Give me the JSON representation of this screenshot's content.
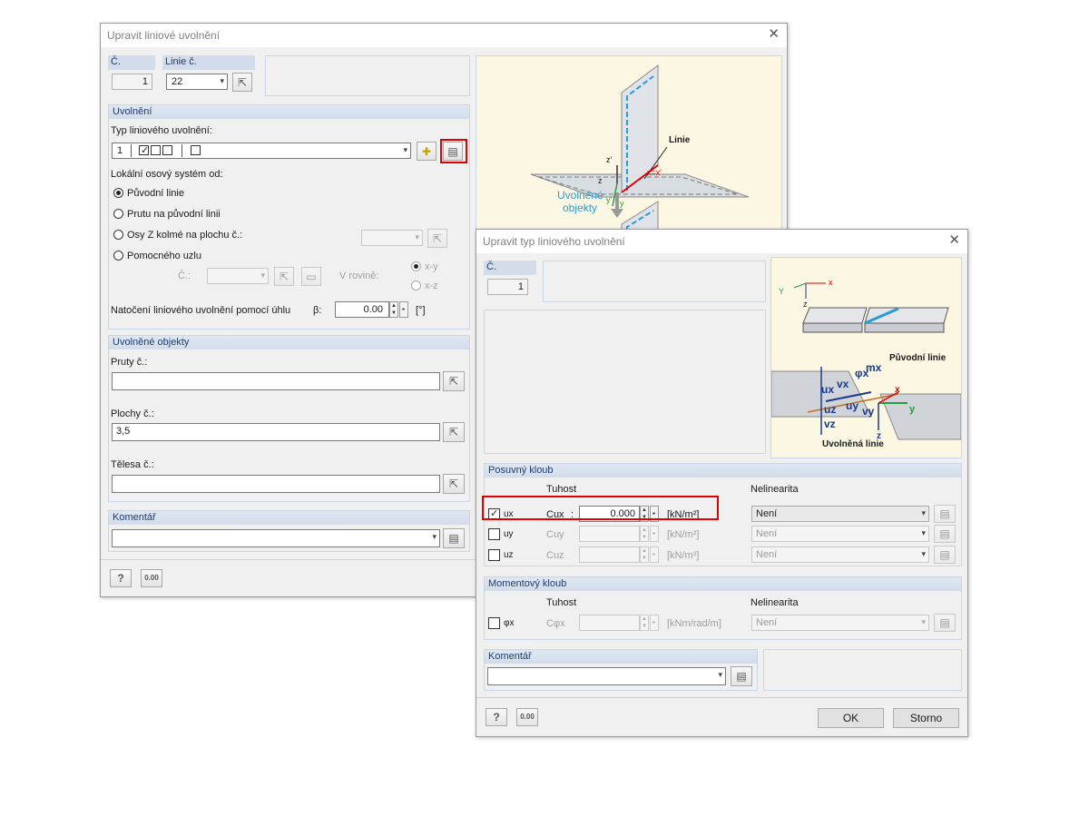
{
  "dlg1": {
    "title": "Upravit liniové uvolnění",
    "no_label": "Č.",
    "no_value": "1",
    "line_label": "Linie č.",
    "line_value": "22",
    "release_group": "Uvolnění",
    "type_label": "Typ liniového uvolnění:",
    "type_value": "1",
    "axes_label": "Lokální osový systém od:",
    "radio_original": "Původní linie",
    "radio_member": "Prutu na původní linii",
    "radio_zaxis": "Osy Z kolmé na plochu č.:",
    "radio_helper": "Pomocného uzlu",
    "node_no_label": "Č.:",
    "plane_label": "V rovině:",
    "plane_xy": "x-y",
    "plane_xz": "x-z",
    "rotation_label": "Natočení liniového uvolnění pomocí úhlu",
    "beta_label": "β:",
    "beta_value": "0.00",
    "beta_unit": "[°]",
    "released_group": "Uvolněné objekty",
    "members_label": "Pruty č.:",
    "members_value": "",
    "surfaces_label": "Plochy č.:",
    "surfaces_value": "3,5",
    "solids_label": "Tělesa č.:",
    "solids_value": "",
    "comment_group": "Komentář",
    "comment_value": "",
    "diagram": {
      "line_label": "Linie",
      "released_label1": "Uvolněné",
      "released_label2": "objekty",
      "axis_z": "z",
      "axis_zp": "z'",
      "axis_y": "y",
      "axis_yp": "y'",
      "axis_xx": "x=x'"
    }
  },
  "dlg2": {
    "title": "Upravit typ liniového uvolnění",
    "no_label": "Č.",
    "no_value": "1",
    "translation_group": "Posuvný kloub",
    "stiffness_label": "Tuhost",
    "nonlinearity_label": "Nelinearita",
    "rows": [
      {
        "name": "ux",
        "checked": true,
        "c": "Cux",
        "value": "0.000",
        "unit": "[kN/m²]",
        "nl": "Není"
      },
      {
        "name": "uy",
        "checked": false,
        "c": "Cuy",
        "value": "",
        "unit": "[kN/m²]",
        "nl": "Není"
      },
      {
        "name": "uz",
        "checked": false,
        "c": "Cuz",
        "value": "",
        "unit": "[kN/m²]",
        "nl": "Není"
      }
    ],
    "moment_group": "Momentový kloub",
    "moment_row": {
      "name": "φx",
      "checked": false,
      "c": "Cφx",
      "value": "",
      "unit": "[kNm/rad/m]",
      "nl": "Není"
    },
    "comment_group": "Komentář",
    "comment_value": "",
    "ok_label": "OK",
    "cancel_label": "Storno",
    "diagram": {
      "x": "x",
      "y": "Y",
      "z": "z",
      "orig_line": "Původní linie",
      "rel_line": "Uvolněná linie",
      "mx": "mx",
      "phix": "φx",
      "vx": "vx",
      "ux": "ux",
      "uz": "uz",
      "vz": "vz",
      "uy": "uy",
      "vy": "vy",
      "ax_x": "x",
      "ax_y": "y",
      "ax_z": "z"
    }
  },
  "colors": {
    "accent_red": "#e00000",
    "group_header": "#d2dcea",
    "header_text": "#1e3c6e"
  }
}
